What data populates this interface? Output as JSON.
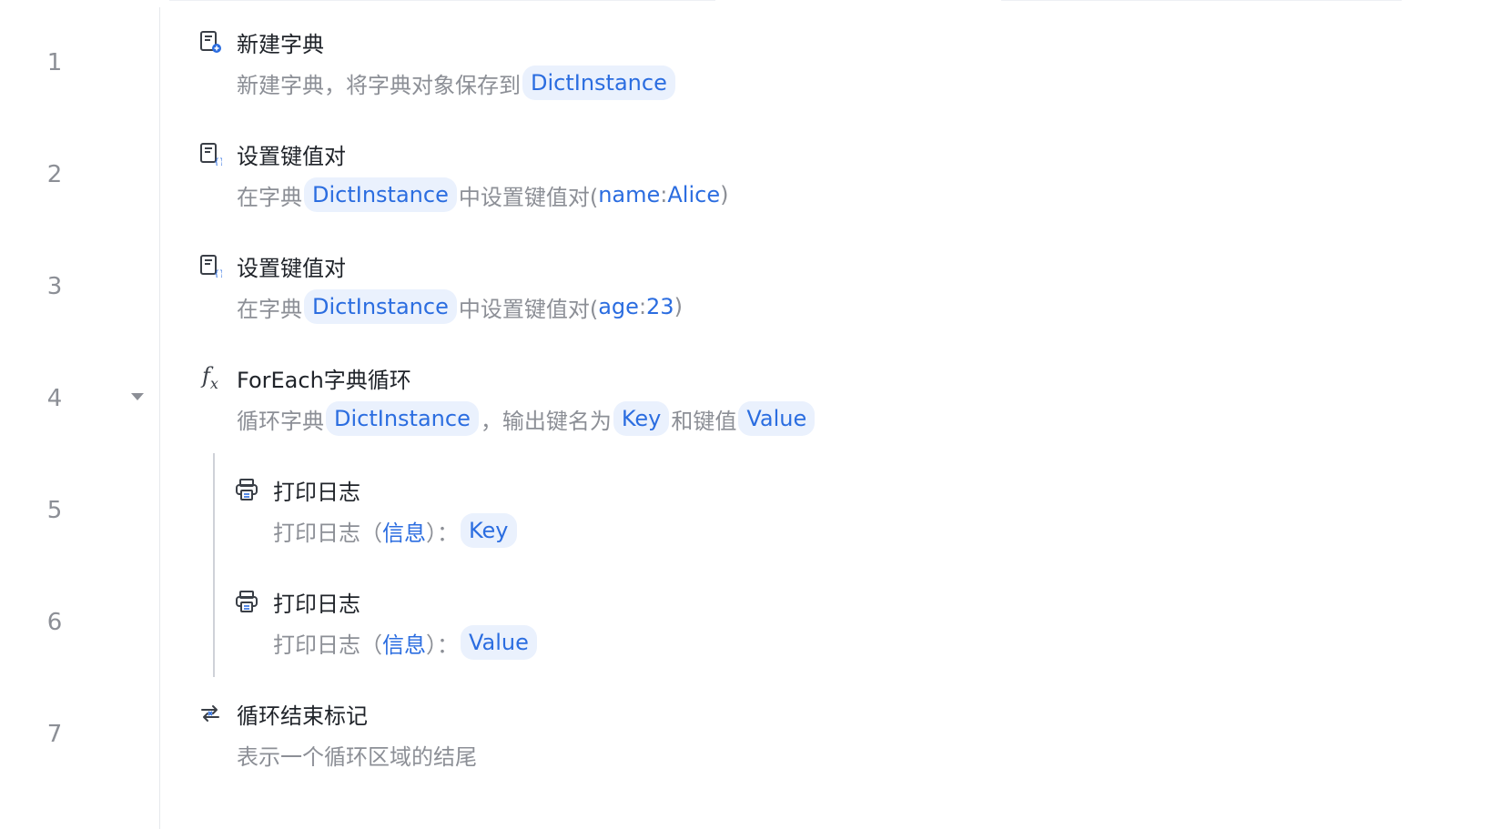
{
  "line_numbers": [
    "1",
    "2",
    "3",
    "4",
    "5",
    "6",
    "7"
  ],
  "steps": [
    {
      "icon": "dictionary-add-icon",
      "title": "新建字典",
      "desc": {
        "text1": "新建字典，将字典对象保存到",
        "var1": "DictInstance"
      }
    },
    {
      "icon": "dictionary-set-icon",
      "title": "设置键值对",
      "desc": {
        "text1": "在字典",
        "var1": "DictInstance",
        "text2": "中设置键值对(",
        "key": "name",
        "sep": ":",
        "value": "Alice",
        "close": ")"
      }
    },
    {
      "icon": "dictionary-set-icon",
      "title": "设置键值对",
      "desc": {
        "text1": "在字典",
        "var1": "DictInstance",
        "text2": "中设置键值对(",
        "key": "age",
        "sep": ":",
        "value": "23",
        "close": ")"
      }
    },
    {
      "icon": "function-fx-icon",
      "fx_symbol": "f",
      "fx_sub": "x",
      "title": "ForEach字典循环",
      "desc": {
        "text1": "循环字典",
        "var1": "DictInstance",
        "text2": "，输出键名为",
        "var2": "Key",
        "text3": "和键值",
        "var3": "Value"
      }
    },
    {
      "icon": "printer-icon",
      "title": "打印日志",
      "desc": {
        "text1": "打印日志（",
        "param": "信息",
        "text2": "）：",
        "var1": "Key"
      }
    },
    {
      "icon": "printer-icon",
      "title": "打印日志",
      "desc": {
        "text1": "打印日志（",
        "param": "信息",
        "text2": "）：",
        "var1": "Value"
      }
    },
    {
      "icon": "loop-end-icon",
      "title": "循环结束标记",
      "desc": {
        "text1": "表示一个循环区域的结尾"
      }
    }
  ],
  "colors": {
    "accent": "#2b6de0",
    "chip_bg": "#eaf1fd",
    "muted_text": "#8c8f96",
    "title_text": "#1f2329"
  }
}
